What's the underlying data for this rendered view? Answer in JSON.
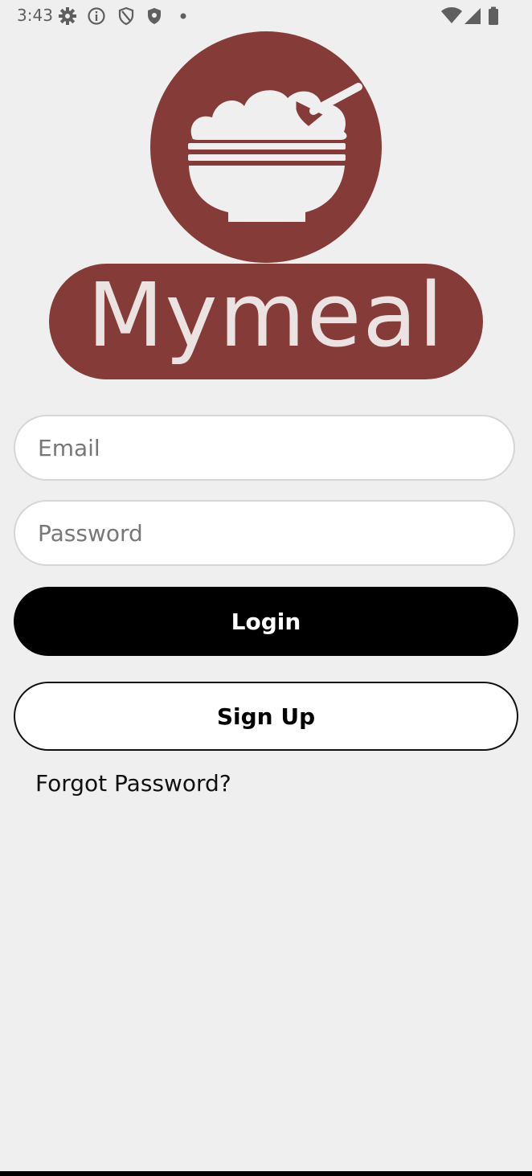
{
  "status_bar": {
    "time": "3:43",
    "icons": [
      "settings-icon",
      "info-icon",
      "shield-icon",
      "shield-filled-icon",
      "notification-dot-icon",
      "wifi-icon",
      "signal-icon",
      "battery-icon"
    ]
  },
  "logo": {
    "text": "Mymeal",
    "color": "#853b37"
  },
  "login_form": {
    "email_placeholder": "Email",
    "password_placeholder": "Password",
    "login_label": "Login",
    "signup_label": "Sign Up",
    "forgot_label": "Forgot Password?"
  }
}
